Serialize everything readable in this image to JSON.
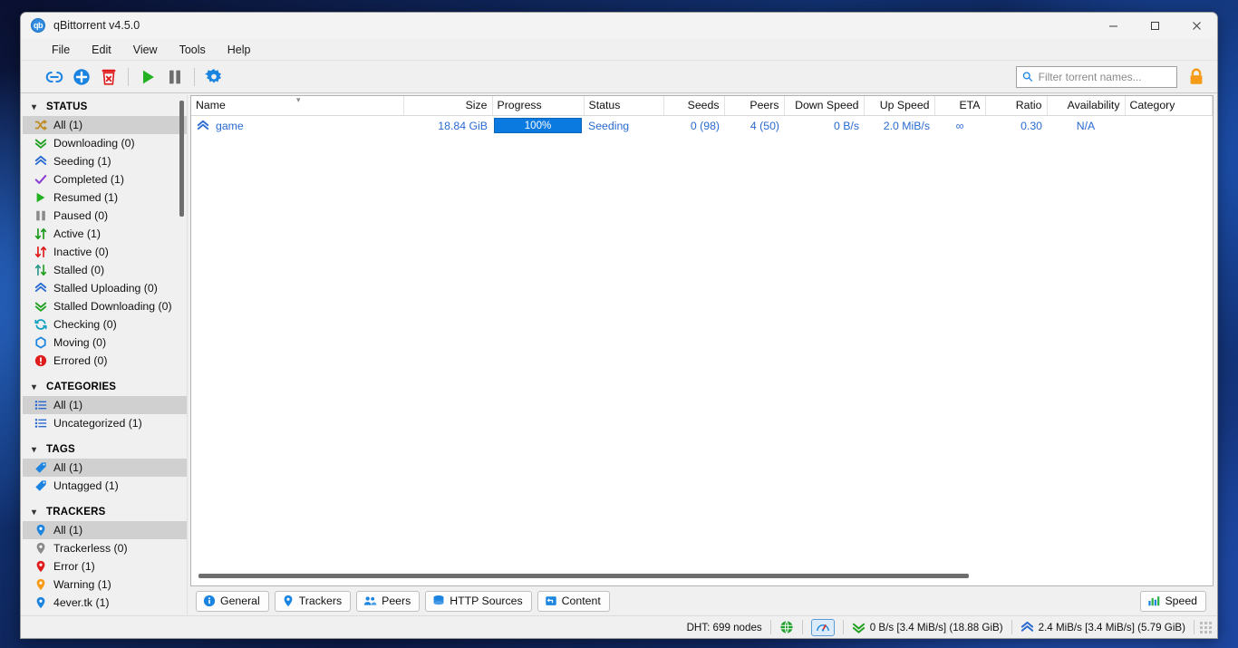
{
  "window": {
    "title": "qBittorrent v4.5.0",
    "app_icon": "qb",
    "minimize": "minimize-icon",
    "maximize": "maximize-icon",
    "close": "close-icon"
  },
  "menubar": {
    "items": [
      "File",
      "Edit",
      "View",
      "Tools",
      "Help"
    ]
  },
  "toolbar": {
    "buttons": [
      {
        "name": "add-torrent-link-button",
        "icon": "link-icon"
      },
      {
        "name": "add-torrent-file-button",
        "icon": "plus-circle-icon"
      },
      {
        "name": "delete-torrent-button",
        "icon": "trash-icon"
      },
      {
        "name": "resume-button",
        "icon": "play-icon"
      },
      {
        "name": "pause-button",
        "icon": "pause-icon"
      },
      {
        "name": "options-button",
        "icon": "gear-icon"
      }
    ],
    "search_placeholder": "Filter torrent names...",
    "search_value": "",
    "lock_icon": "padlock-icon"
  },
  "sidebar": {
    "sections": [
      {
        "title": "STATUS",
        "items": [
          {
            "label": "All (1)",
            "icon": "shuffle-icon",
            "selected": true
          },
          {
            "label": "Downloading (0)",
            "icon": "double-chevron-down-icon",
            "selected": false
          },
          {
            "label": "Seeding (1)",
            "icon": "double-chevron-up-icon",
            "selected": false
          },
          {
            "label": "Completed (1)",
            "icon": "check-icon",
            "selected": false
          },
          {
            "label": "Resumed (1)",
            "icon": "play-icon",
            "selected": false
          },
          {
            "label": "Paused (0)",
            "icon": "pause-icon",
            "selected": false
          },
          {
            "label": "Active (1)",
            "icon": "up-down-arrows-green-icon",
            "selected": false
          },
          {
            "label": "Inactive (0)",
            "icon": "up-down-arrows-red-icon",
            "selected": false
          },
          {
            "label": "Stalled (0)",
            "icon": "up-down-arrows-teal-icon",
            "selected": false
          },
          {
            "label": "Stalled Uploading (0)",
            "icon": "double-chevron-up-icon",
            "selected": false
          },
          {
            "label": "Stalled Downloading (0)",
            "icon": "double-chevron-down-icon",
            "selected": false
          },
          {
            "label": "Checking (0)",
            "icon": "refresh-icon",
            "selected": false
          },
          {
            "label": "Moving (0)",
            "icon": "hexagon-outline-icon",
            "selected": false
          },
          {
            "label": "Errored (0)",
            "icon": "error-icon",
            "selected": false
          }
        ]
      },
      {
        "title": "CATEGORIES",
        "items": [
          {
            "label": "All (1)",
            "icon": "list-icon",
            "selected": true
          },
          {
            "label": "Uncategorized (1)",
            "icon": "list-icon",
            "selected": false
          }
        ]
      },
      {
        "title": "TAGS",
        "items": [
          {
            "label": "All (1)",
            "icon": "tag-icon",
            "selected": true
          },
          {
            "label": "Untagged (1)",
            "icon": "tag-icon",
            "selected": false
          }
        ]
      },
      {
        "title": "TRACKERS",
        "items": [
          {
            "label": "All (1)",
            "icon": "pin-blue-icon",
            "selected": true
          },
          {
            "label": "Trackerless (0)",
            "icon": "pin-grey-icon",
            "selected": false
          },
          {
            "label": "Error (1)",
            "icon": "pin-red-icon",
            "selected": false
          },
          {
            "label": "Warning (1)",
            "icon": "pin-orange-icon",
            "selected": false
          },
          {
            "label": "4ever.tk (1)",
            "icon": "pin-blue-icon",
            "selected": false
          }
        ]
      }
    ]
  },
  "table": {
    "columns": [
      "Name",
      "Size",
      "Progress",
      "Status",
      "Seeds",
      "Peers",
      "Down Speed",
      "Up Speed",
      "ETA",
      "Ratio",
      "Availability",
      "Category"
    ],
    "sort_indicator": "descending",
    "rows": [
      {
        "name": "game",
        "status_icon": "double-chevron-up-icon",
        "size": "18.84 GiB",
        "progress": "100%",
        "progress_value": 100,
        "status": "Seeding",
        "seeds": "0 (98)",
        "peers": "4 (50)",
        "down_speed": "0 B/s",
        "up_speed": "2.0 MiB/s",
        "eta": "∞",
        "ratio": "0.30",
        "availability": "N/A",
        "category": ""
      }
    ]
  },
  "tabs": [
    {
      "label": "General",
      "icon": "info-icon"
    },
    {
      "label": "Trackers",
      "icon": "pin-blue-icon"
    },
    {
      "label": "Peers",
      "icon": "people-icon"
    },
    {
      "label": "HTTP Sources",
      "icon": "database-icon"
    },
    {
      "label": "Content",
      "icon": "content-icon"
    }
  ],
  "speed_button": {
    "label": "Speed",
    "icon": "bar-chart-icon"
  },
  "statusbar": {
    "dht": "DHT: 699 nodes",
    "connection_icon": "globe-green-icon",
    "altspeed_icon": "speedometer-icon",
    "download_icon": "double-chevron-down-icon",
    "download": "0 B/s [3.4 MiB/s] (18.88 GiB)",
    "upload_icon": "double-chevron-up-icon",
    "upload": "2.4 MiB/s [3.4 MiB/s] (5.79 GiB)"
  },
  "colors": {
    "accent_blue": "#0a7ae0",
    "link_blue": "#2a6ad0",
    "green": "#21a02a",
    "red": "#e01b1b",
    "orange": "#f59b18",
    "selection_grey": "#d0d0d0"
  }
}
